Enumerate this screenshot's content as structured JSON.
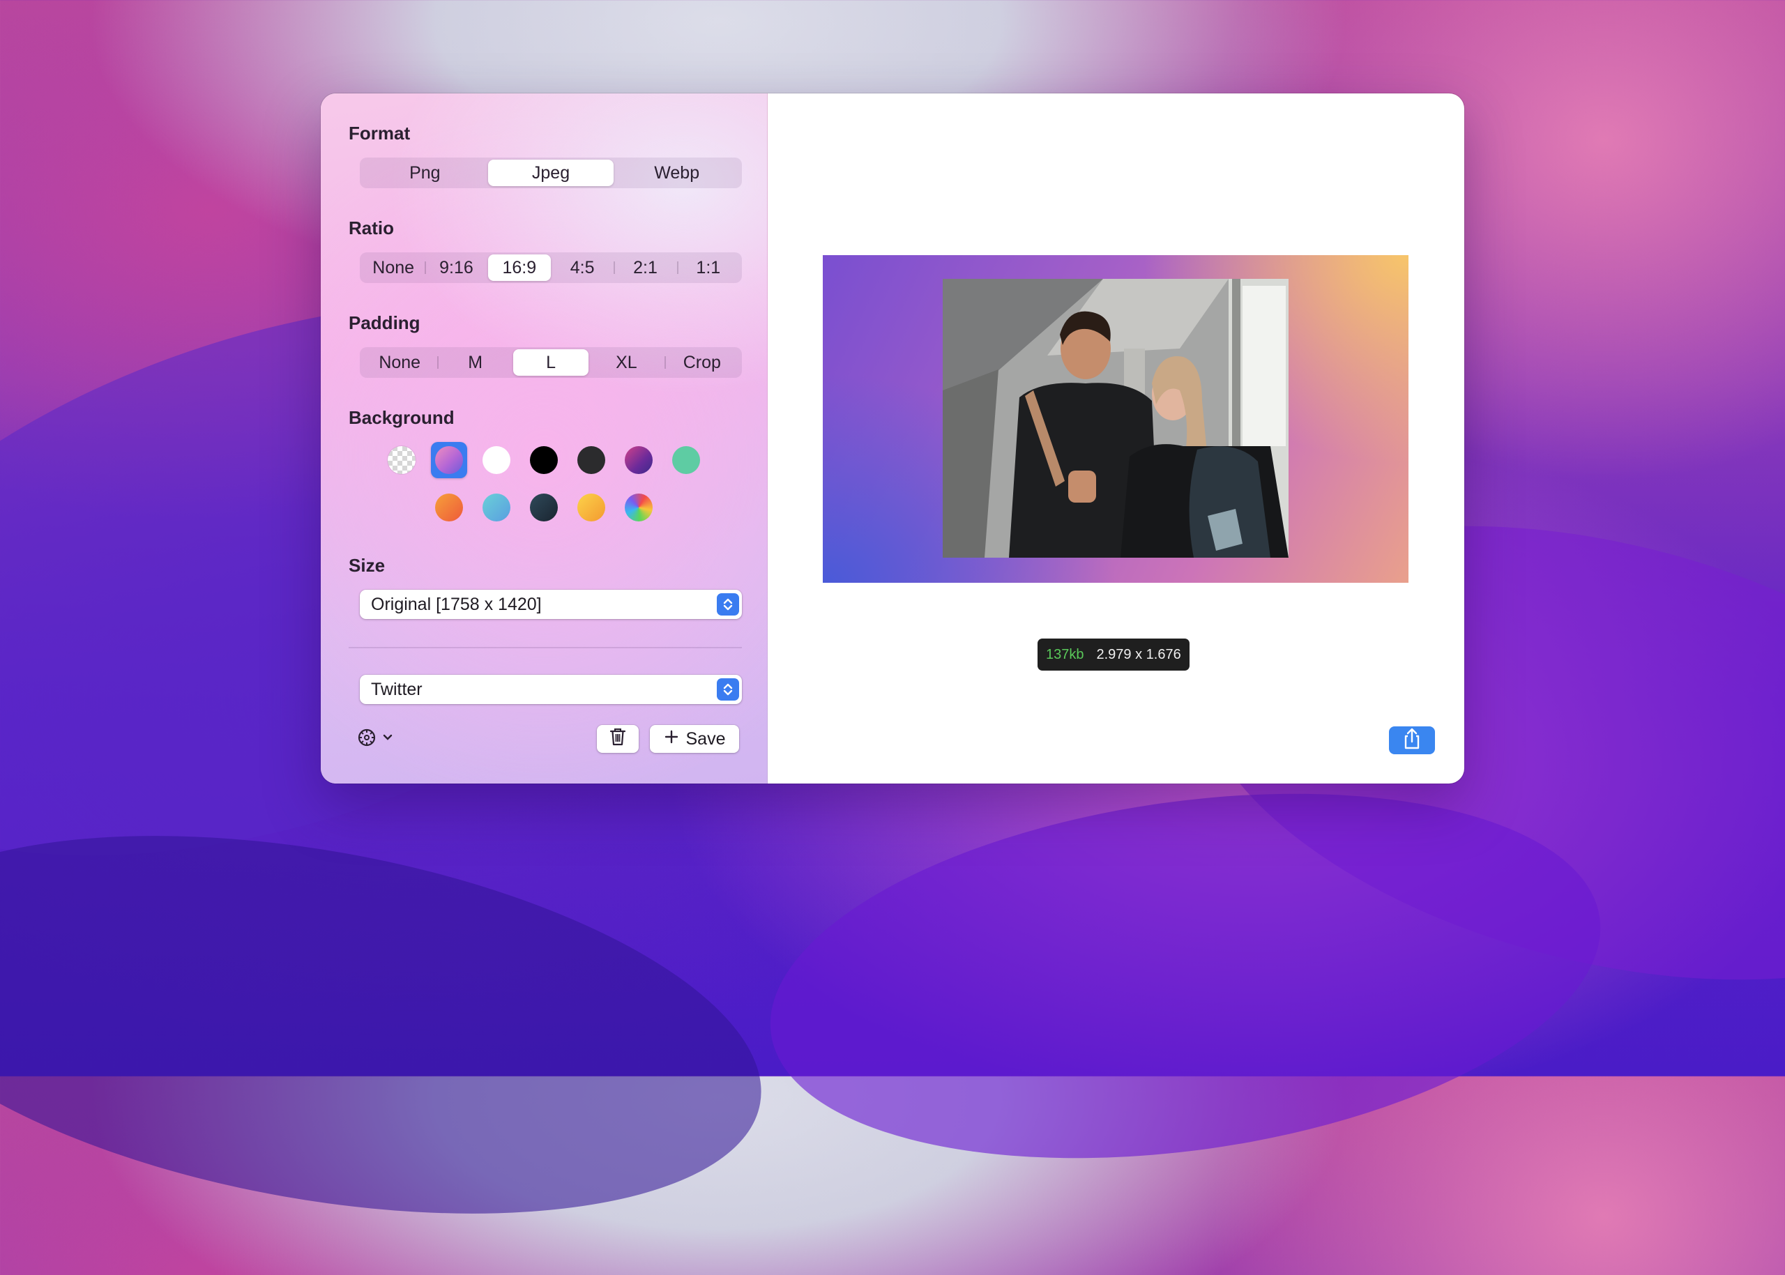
{
  "sidebar": {
    "format": {
      "label": "Format",
      "options": [
        "Png",
        "Jpeg",
        "Webp"
      ],
      "selected": "Jpeg"
    },
    "ratio": {
      "label": "Ratio",
      "options": [
        "None",
        "9:16",
        "16:9",
        "4:5",
        "2:1",
        "1:1"
      ],
      "selected": "16:9"
    },
    "padding": {
      "label": "Padding",
      "options": [
        "None",
        "M",
        "L",
        "XL",
        "Crop"
      ],
      "selected": "L"
    },
    "background": {
      "label": "Background",
      "swatches_row1": [
        "transparent-checker",
        "pink-purple-gradient",
        "#ffffff",
        "#000000",
        "#2b2b2d",
        "magenta-indigo-gradient",
        "#5ecca3"
      ],
      "swatches_row2": [
        "orange-red-gradient",
        "teal-blue-gradient",
        "#243444",
        "yellow-orange-gradient",
        "rainbow-gradient"
      ],
      "selected_index": 1
    },
    "size": {
      "label": "Size",
      "value": "Original [1758 x 1420]"
    },
    "preset": {
      "value": "Twitter"
    },
    "actions": {
      "settings_icon": "gear-icon",
      "delete_icon": "trash-icon",
      "save_label": "Save"
    }
  },
  "preview": {
    "file_size": "137kb",
    "dimensions": "2.979 x 1.676",
    "share_icon": "share-icon"
  },
  "colors": {
    "accent": "#3a7cf0",
    "file_size_text": "#5ac85a"
  }
}
